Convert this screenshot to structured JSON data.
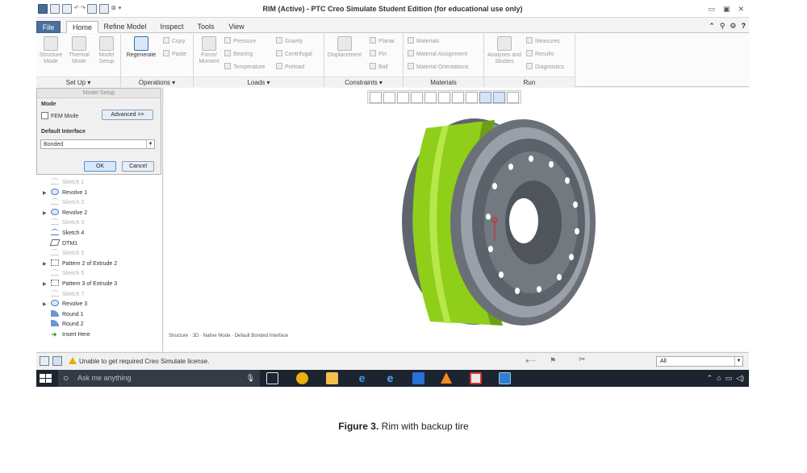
{
  "window": {
    "title": "RIM (Active) - PTC Creo Simulate Student Edition (for educational use only)",
    "controls": [
      "▭",
      "▣",
      "✕"
    ]
  },
  "tabs": {
    "file": "File",
    "items": [
      "Home",
      "Refine Model",
      "Inspect",
      "Tools",
      "View"
    ],
    "active": "Home"
  },
  "ribbon": {
    "setup": {
      "label": "Set Up",
      "structure": "Structure Mode",
      "thermal": "Thermal Mode",
      "model_setup": "Model Setup"
    },
    "operations": {
      "label": "Operations",
      "regenerate": "Regenerate",
      "copy": "Copy",
      "paste": "Paste"
    },
    "loads": {
      "label": "Loads",
      "force_moment": "Force/ Moment",
      "pressure": "Pressure",
      "bearing": "Bearing",
      "temperature": "Temperature",
      "gravity": "Gravity",
      "centrifugal": "Centrifugal",
      "preload": "Preload"
    },
    "constraints": {
      "label": "Constraints",
      "displacement": "Displacement",
      "planar": "Planar",
      "pin": "Pin",
      "ball": "Ball"
    },
    "materials": {
      "label": "Materials",
      "materials": "Materials",
      "assignment": "Material Assignment",
      "orientations": "Material Orientations"
    },
    "run": {
      "label": "Run",
      "analyses": "Analyses and Studies",
      "measures": "Measures",
      "results": "Results",
      "diagnostics": "Diagnostics"
    }
  },
  "dialog": {
    "title": "Model Setup",
    "mode_label": "Mode",
    "fem_mode": "FEM Mode",
    "advanced": "Advanced >>",
    "interface_label": "Default Interface",
    "interface_value": "Bonded",
    "ok": "OK",
    "cancel": "Cancel"
  },
  "tree": [
    {
      "label": "Sketch 1",
      "icon": "sketch",
      "dim": true,
      "expand": false
    },
    {
      "label": "Revolve 1",
      "icon": "revolve",
      "dim": false,
      "expand": true
    },
    {
      "label": "Sketch 2",
      "icon": "sketch",
      "dim": true,
      "expand": false
    },
    {
      "label": "Revolve 2",
      "icon": "revolve",
      "dim": false,
      "expand": true
    },
    {
      "label": "Sketch 3",
      "icon": "sketch",
      "dim": true,
      "expand": false
    },
    {
      "label": "Sketch 4",
      "icon": "sketch",
      "dim": false,
      "expand": false
    },
    {
      "label": "DTM1",
      "icon": "datum",
      "dim": false,
      "expand": false
    },
    {
      "label": "Sketch 5",
      "icon": "sketch",
      "dim": true,
      "expand": false
    },
    {
      "label": "Pattern 2 of Extrude 2",
      "icon": "pattern",
      "dim": false,
      "expand": true
    },
    {
      "label": "Sketch 6",
      "icon": "sketch",
      "dim": true,
      "expand": false
    },
    {
      "label": "Pattern 3 of Extrude 3",
      "icon": "pattern",
      "dim": false,
      "expand": true
    },
    {
      "label": "Sketch 7",
      "icon": "sketch",
      "dim": true,
      "expand": false
    },
    {
      "label": "Revolve 3",
      "icon": "revolve",
      "dim": false,
      "expand": true
    },
    {
      "label": "Round 1",
      "icon": "round",
      "dim": false,
      "expand": false
    },
    {
      "label": "Round 2",
      "icon": "round",
      "dim": false,
      "expand": false
    },
    {
      "label": "Insert Here",
      "icon": "insert",
      "dim": false,
      "expand": false
    }
  ],
  "viewport": {
    "status_info": "Structure · 3D · Native Mode · Default Bonded Interface"
  },
  "statusbar": {
    "warning": "Unable to get required Creo Simulate license.",
    "filter": "All"
  },
  "taskbar": {
    "search_placeholder": "Ask me anything"
  },
  "caption": {
    "label": "Figure 3.",
    "text": " Rim with backup tire"
  },
  "colors": {
    "tire": "#8fcf1a",
    "rim": "#707781",
    "file_tab": "#4a6f9a",
    "taskbar": "#1c2430"
  }
}
